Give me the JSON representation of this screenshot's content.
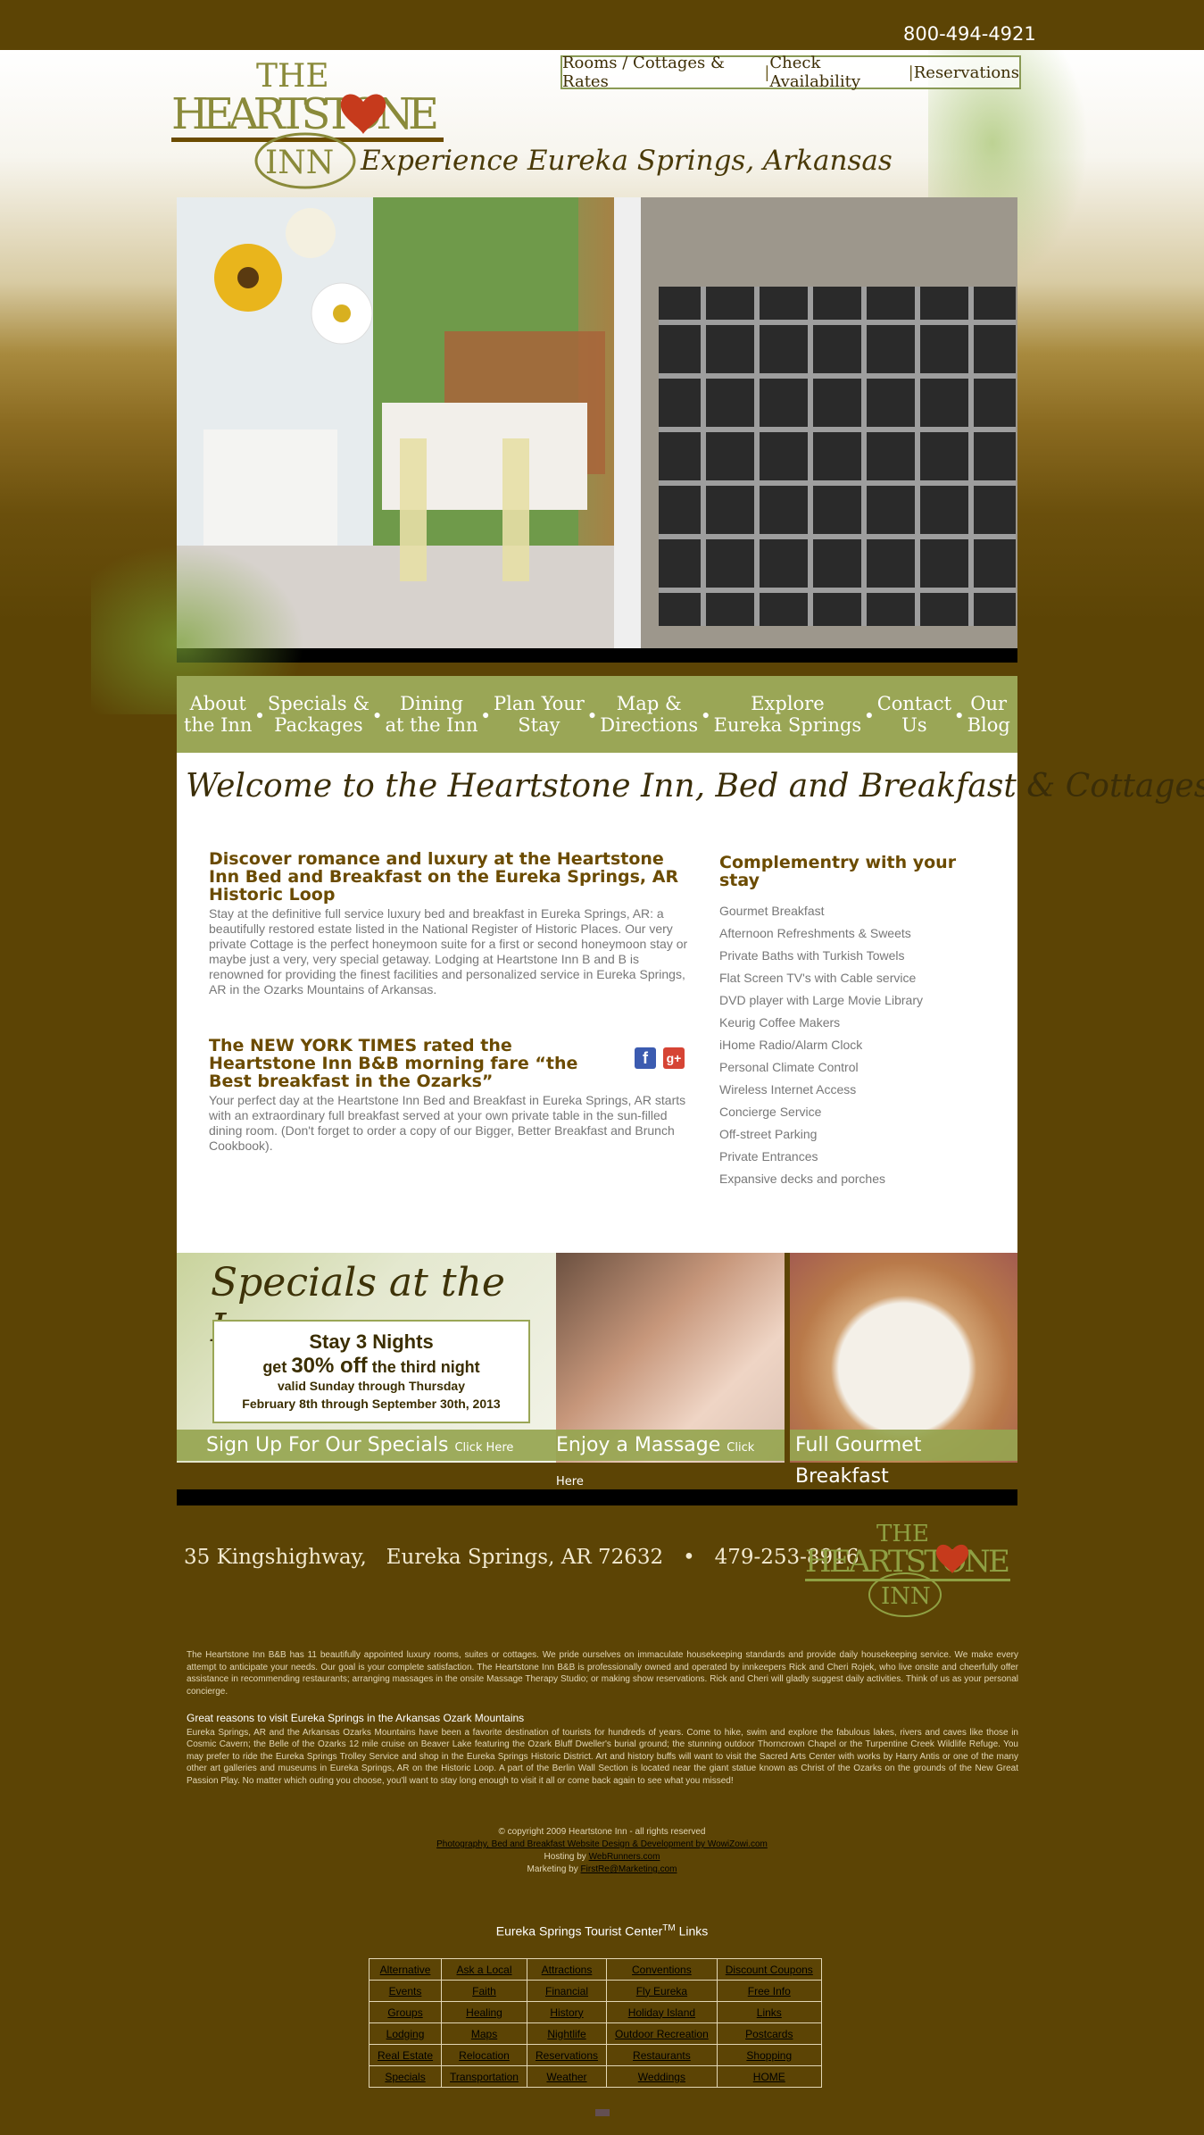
{
  "header": {
    "phone": "800-494-4921",
    "topnav": [
      "Rooms / Cottages & Rates",
      "Check Availability",
      "Reservations"
    ],
    "logo_text": "THE HEARTSTONE INN",
    "tagline": "Experience Eureka Springs, Arkansas"
  },
  "nav": [
    {
      "line1": "About",
      "line2": "the Inn"
    },
    {
      "line1": "Specials &",
      "line2": "Packages"
    },
    {
      "line1": "Dining",
      "line2": "at the Inn"
    },
    {
      "line1": "Plan Your",
      "line2": "Stay"
    },
    {
      "line1": "Map &",
      "line2": "Directions"
    },
    {
      "line1": "Explore",
      "line2": "Eureka Springs"
    },
    {
      "line1": "Contact",
      "line2": "Us"
    },
    {
      "line1": "Our",
      "line2": "Blog"
    }
  ],
  "welcome": "Welcome to the Heartstone Inn, Bed and Breakfast & Cottages",
  "intro": {
    "heading": "Discover romance and luxury at the Heartstone Inn Bed and Breakfast on the Eureka Springs, AR Historic Loop",
    "body": "Stay at the definitive full service luxury bed and breakfast in Eureka Springs, AR: a beautifully restored estate listed in the National Register of Historic Places. Our very private Cottage is the perfect honeymoon suite for a first or second honeymoon stay or maybe just a very, very special getaway. Lodging at Heartstone Inn B and B is renowned for providing the finest facilities and personalized service in Eureka Springs, AR in the Ozarks Mountains of Arkansas."
  },
  "nyt": {
    "heading": "The NEW YORK TIMES rated the Heartstone Inn B&B morning fare “the Best breakfast in the Ozarks”",
    "body": "Your perfect day at the Heartstone Inn Bed and Breakfast in Eureka Springs, AR starts with an extraordinary full breakfast served at your own private table in the sun-filled dining room. (Don't forget to order a copy of our Bigger, Better Breakfast and Brunch Cookbook).",
    "social": {
      "facebook": "f",
      "google": "g+"
    }
  },
  "amenities": {
    "heading": "Complementry with your stay",
    "items": [
      "Gourmet Breakfast",
      "Afternoon Refreshments & Sweets",
      "Private Baths with Turkish Towels",
      "Flat Screen TV's with Cable service",
      "DVD player with Large Movie Library",
      "Keurig Coffee Makers",
      "iHome Radio/Alarm Clock",
      "Personal Climate Control",
      "Wireless Internet Access",
      "Concierge Service",
      "Off-street Parking",
      "Private Entrances",
      "Expansive decks and porches"
    ]
  },
  "promos": {
    "specials_title": "Specials at the Inn",
    "offer_line1": "Stay 3 Nights",
    "offer_get": "get",
    "offer_big": "30% off",
    "offer_rest": "the third night",
    "offer_line3": "valid Sunday through Thursday",
    "offer_line4": "February 8th through September 30th, 2013",
    "signup": "Sign Up For Our Specials",
    "massage": "Enjoy a Massage",
    "click_here": "Click Here",
    "breakfast": "Full Gourmet Breakfast"
  },
  "footer": {
    "address": "35 Kingshighway,",
    "city": "Eureka Springs, AR 72632",
    "bullet": "•",
    "phone": "479-253-8916",
    "about": "The Heartstone Inn B&B has 11 beautifully appointed luxury rooms, suites or cottages. We pride ourselves on immaculate housekeeping standards and provide daily housekeeping service. We make every attempt to anticipate your needs. Our goal is your complete satisfaction. The Heartstone Inn B&B is professionally owned and operated by innkeepers Rick and Cheri Rojek, who live onsite and cheerfully offer assistance in recommending restaurants; arranging massages in the onsite Massage Therapy Studio; or making show reservations. Rick and Cheri will gladly suggest daily activities. Think of us as your personal concierge.",
    "reasons_heading": "Great reasons to visit Eureka Springs in the Arkansas Ozark Mountains",
    "reasons": "Eureka Springs, AR and the Arkansas Ozarks Mountains have been a favorite destination of tourists for hundreds of years. Come to hike, swim and explore the fabulous lakes, rivers and caves like those in Cosmic Cavern; the Belle of the Ozarks 12 mile cruise on Beaver Lake featuring the Ozark Bluff Dweller's burial ground; the stunning outdoor Thorncrown Chapel or the Turpentine Creek Wildlife Refuge. You may prefer to ride the Eureka Springs Trolley Service and shop in the Eureka Springs Historic District. Art and history buffs will want to visit the Sacred Arts Center with works by Harry Antis or one of the many other art galleries and museums in Eureka Springs, AR on the Historic Loop. A part of the Berlin Wall Section is located near the giant statue known as Christ of the Ozarks on the grounds of the New Great Passion Play. No matter which outing you choose, you'll want to stay long enough to visit it all or come back again to see what you missed!",
    "copyright": "© copyright 2009 Heartstone Inn - all rights reserved",
    "design": "Photography, Bed and Breakfast Website Design & Development by WowiZowi.com",
    "hosting_label": "Hosting by",
    "hosting": "WebRunners.com",
    "marketing_label": "Marketing by",
    "marketing": "FirstRe@Marketing.com",
    "tourist": "Eureka Springs Tourist Center",
    "tourist_tm": "TM",
    "tourist_links": "Links",
    "links": [
      [
        "Alternative",
        "Ask a Local",
        "Attractions",
        "Conventions",
        "Discount Coupons"
      ],
      [
        "Events",
        "Faith",
        "Financial",
        "Fly Eureka",
        "Free Info"
      ],
      [
        "Groups",
        "Healing",
        "History",
        "Holiday Island",
        "Links"
      ],
      [
        "Lodging",
        "Maps",
        "Nightlife",
        "Outdoor Recreation",
        "Postcards"
      ],
      [
        "Real Estate",
        "Relocation",
        "Reservations",
        "Restaurants",
        "Shopping"
      ],
      [
        "Specials",
        "Transportation",
        "Weather",
        "Weddings",
        "HOME"
      ]
    ]
  },
  "colors": {
    "brand_brown": "#5c4405",
    "nav_green": "#9aa656",
    "heading_brown": "#6b4b00",
    "heart_red": "#c63a1c"
  }
}
